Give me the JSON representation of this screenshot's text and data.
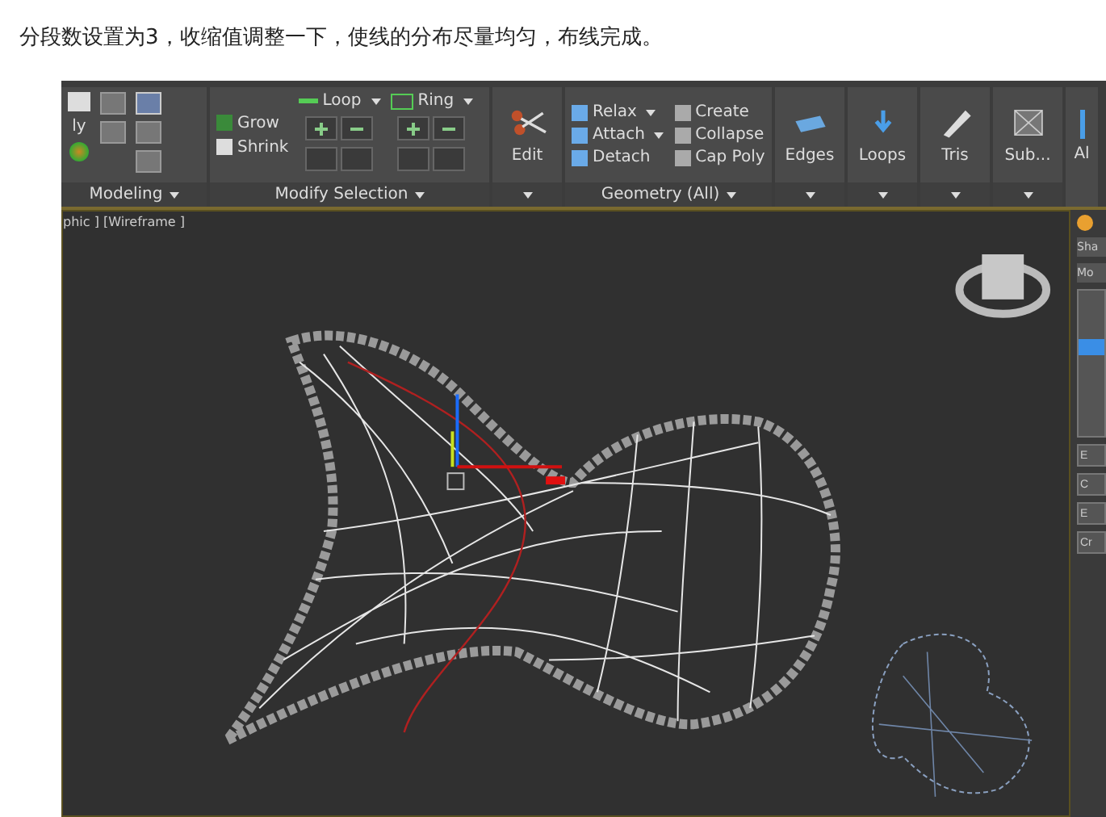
{
  "caption": "分段数设置为3，收缩值调整一下，使线的分布尽量均匀，布线完成。",
  "ribbon": {
    "modeling": {
      "item": "ly",
      "label": "Modeling"
    },
    "modify_selection": {
      "label": "Modify Selection",
      "grow": "Grow",
      "shrink": "Shrink",
      "loop": "Loop",
      "ring": "Ring"
    },
    "edit": {
      "label": "Edit"
    },
    "geometry": {
      "label": "Geometry (All)",
      "items": [
        {
          "label": "Relax",
          "dropdown": true
        },
        {
          "label": "Create",
          "dropdown": false
        },
        {
          "label": "Attach",
          "dropdown": true
        },
        {
          "label": "Collapse",
          "dropdown": false
        },
        {
          "label": "Detach",
          "dropdown": false
        },
        {
          "label": "Cap Poly",
          "dropdown": false
        }
      ]
    },
    "big_buttons": [
      {
        "label": "Edges",
        "kind": "edges"
      },
      {
        "label": "Loops",
        "kind": "loops"
      },
      {
        "label": "Tris",
        "kind": "tris"
      },
      {
        "label": "Sub...",
        "kind": "sub"
      },
      {
        "label": "Al",
        "kind": "cut"
      }
    ]
  },
  "viewport": {
    "label": "phic ] [Wireframe ]"
  },
  "side_panel": {
    "fields": [
      "Sha",
      "Mo"
    ],
    "buttons": [
      "E",
      "C",
      "E",
      "Cr"
    ]
  }
}
